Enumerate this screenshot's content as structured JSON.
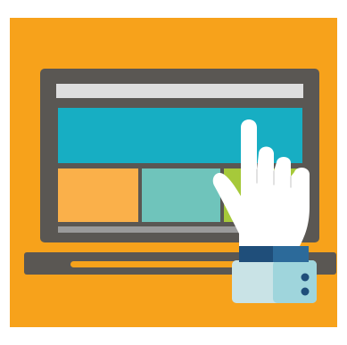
{
  "illustration": {
    "subject": "laptop-with-pointing-hand",
    "colors": {
      "page_background": "#ffffff",
      "panel_background": "#f7a21b",
      "laptop_body": "#5a5753",
      "laptop_base": "#5a5753",
      "base_slot": "#f7a21b",
      "screen_bar": "#dedede",
      "screen_hero": "#17aec3",
      "tile_orange": "#fab04a",
      "tile_teal": "#6fc4bb",
      "tile_green": "#a6c93a",
      "screen_strip": "#9a9a9a",
      "hand": "#ffffff",
      "hand_outline": "#2a2a2a",
      "sleeve_cuff": "#1f4e7a",
      "sleeve_cuff_light": "#2c6a9a",
      "sleeve": "#c9e3e6",
      "sleeve_accent": "#9fd5dc",
      "sleeve_button": "#1f4e7a"
    },
    "icons": [
      "laptop-icon",
      "pointing-hand-icon"
    ]
  }
}
